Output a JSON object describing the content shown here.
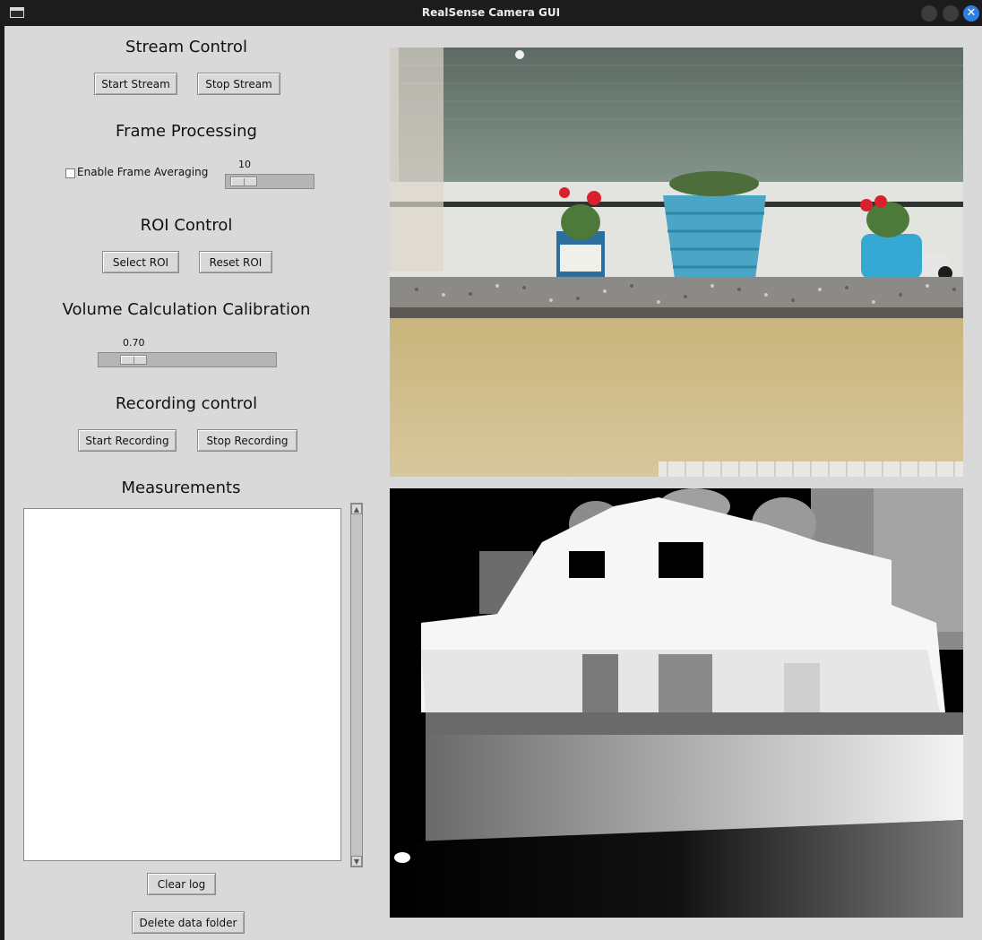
{
  "window": {
    "title": "RealSense Camera GUI",
    "close_glyph": "✕"
  },
  "stream_control": {
    "heading": "Stream Control",
    "start_label": "Start Stream",
    "stop_label": "Stop Stream"
  },
  "frame_processing": {
    "heading": "Frame Processing",
    "averaging_label": "Enable Frame Averaging",
    "averaging_checked": false,
    "scale_value": "10"
  },
  "roi_control": {
    "heading": "ROI Control",
    "select_label": "Select ROI",
    "reset_label": "Reset ROI"
  },
  "calibration": {
    "heading": "Volume Calculation Calibration",
    "scale_value": "0.70"
  },
  "recording": {
    "heading": "Recording control",
    "start_label": "Start Recording",
    "stop_label": "Stop Recording"
  },
  "measurements": {
    "heading": "Measurements",
    "log_lines": [],
    "clear_label": "Clear log",
    "delete_label": "Delete data folder"
  },
  "views": {
    "rgb": "color-camera-feed",
    "depth": "depth-camera-feed"
  }
}
